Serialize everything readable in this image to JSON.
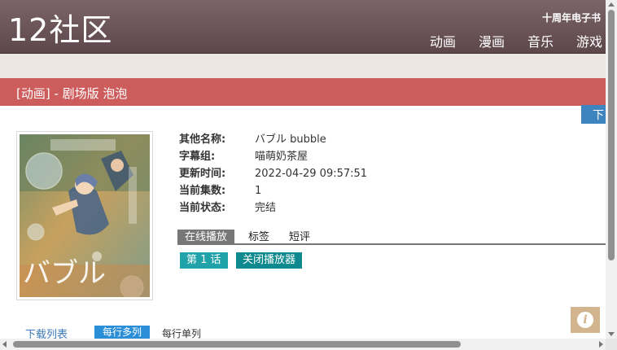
{
  "header": {
    "logo": "12社区",
    "note": "十周年电子书",
    "nav": [
      "动画",
      "漫画",
      "音乐",
      "游戏"
    ]
  },
  "title_bar": "[动画] - 剧场版 泡泡",
  "download_tab": "下",
  "info": [
    {
      "label": "其他名称:",
      "value": "バブル bubble"
    },
    {
      "label": "字幕组:",
      "value": "喵萌奶茶屋"
    },
    {
      "label": "更新时间:",
      "value": "2022-04-29 09:57:51"
    },
    {
      "label": "当前集数:",
      "value": "1"
    },
    {
      "label": "当前状态:",
      "value": "完结"
    }
  ],
  "tabs": {
    "online": "在线播放",
    "tags": "标签",
    "reviews": "短评"
  },
  "episode_button": "第 1 话",
  "close_player_button": "关闭播放器",
  "download_list_label": "下载列表",
  "layout_multi": "每行多列",
  "layout_single": "每行单列",
  "colors": {
    "header": "#6b5459",
    "title_bar": "#cd5c5c",
    "band": "#ede7e3",
    "teal": "#1fa2a8",
    "dark_teal": "#0e8a8e",
    "blue": "#2b8fd8",
    "info_fab": "#d2b58f"
  },
  "icons": {
    "info_fab": "info-icon"
  }
}
